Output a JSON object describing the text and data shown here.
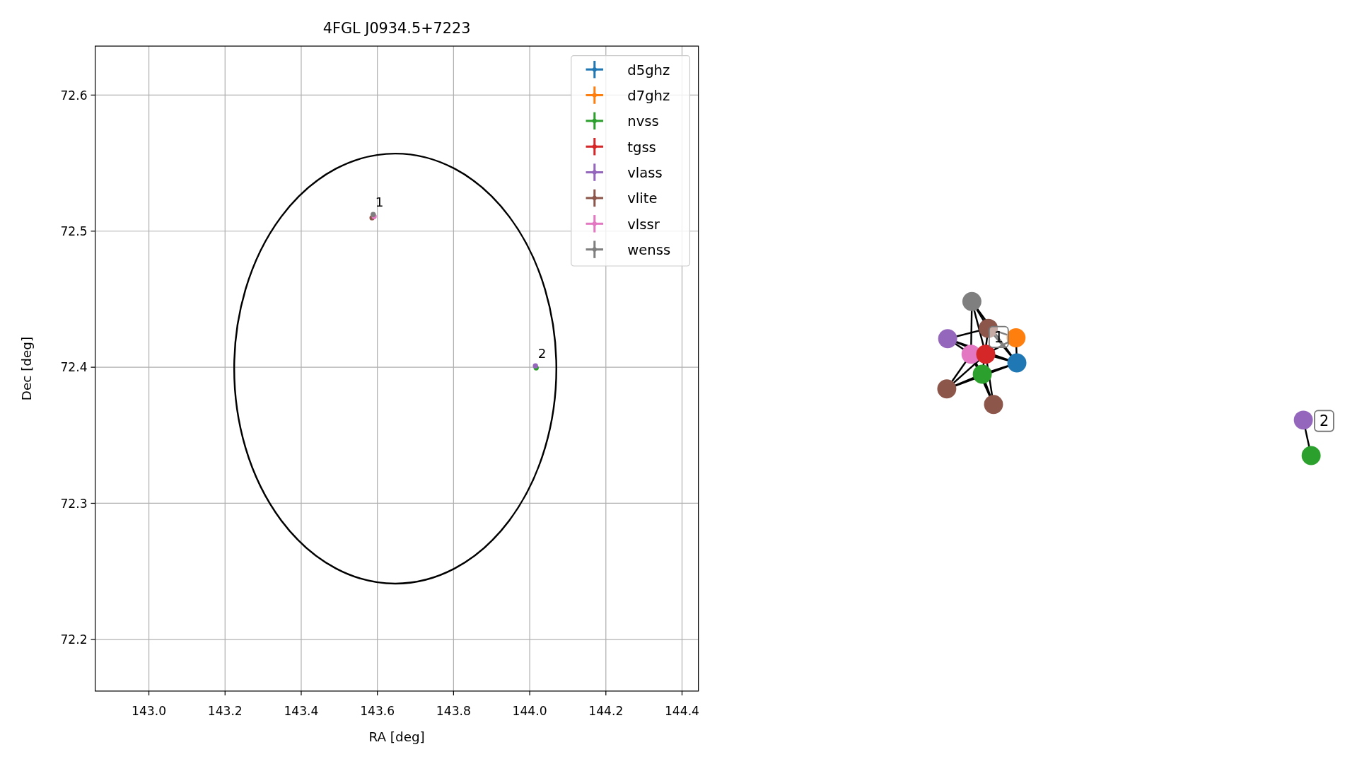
{
  "figure": {
    "chart_data": {
      "type": "scatter",
      "title": "4FGL J0934.5+7223",
      "xlabel": "RA [deg]",
      "ylabel": "Dec [deg]",
      "xlim": [
        142.859,
        144.443
      ],
      "ylim": [
        72.162,
        72.636
      ],
      "grid": true,
      "legend": true,
      "xticks": [
        {
          "value": 143.0,
          "label": "143.0"
        },
        {
          "value": 143.2,
          "label": "143.2"
        },
        {
          "value": 143.4,
          "label": "143.4"
        },
        {
          "value": 143.6,
          "label": "143.6"
        },
        {
          "value": 143.8,
          "label": "143.8"
        },
        {
          "value": 144.0,
          "label": "144.0"
        },
        {
          "value": 144.2,
          "label": "144.2"
        },
        {
          "value": 144.4,
          "label": "144.4"
        }
      ],
      "yticks": [
        {
          "value": 72.2,
          "label": "72.2"
        },
        {
          "value": 72.3,
          "label": "72.3"
        },
        {
          "value": 72.4,
          "label": "72.4"
        },
        {
          "value": 72.5,
          "label": "72.5"
        },
        {
          "value": 72.6,
          "label": "72.6"
        }
      ],
      "series": [
        {
          "name": "d5ghz",
          "color": "#1f77b4"
        },
        {
          "name": "d7ghz",
          "color": "#ff7f0e"
        },
        {
          "name": "nvss",
          "color": "#2ca02c",
          "x": [
            144.017
          ],
          "values": [
            72.3995
          ]
        },
        {
          "name": "tgss",
          "color": "#d62728"
        },
        {
          "name": "vlass",
          "color": "#9467bd",
          "x": [
            144.015
          ],
          "values": [
            72.401
          ]
        },
        {
          "name": "vlite",
          "color": "#8c564b",
          "x": [
            143.586
          ],
          "values": [
            72.5098
          ]
        },
        {
          "name": "vlssr",
          "color": "#e377c2",
          "x": [
            143.5915
          ],
          "values": [
            72.5108
          ]
        },
        {
          "name": "wenss",
          "color": "#7f7f7f",
          "x": [
            143.589
          ],
          "values": [
            72.5122
          ]
        }
      ],
      "annotations": [
        {
          "text": "1",
          "x": 143.59,
          "y": 72.516
        },
        {
          "text": "2",
          "x": 144.017,
          "y": 72.405
        }
      ]
    }
  },
  "network": {
    "clusters": [
      {
        "label": "1",
        "nodes": [
          {
            "color": "#7f7f7f"
          },
          {
            "color": "#8c564b"
          },
          {
            "color": "#9467bd"
          },
          {
            "color": "#ff7f0e"
          },
          {
            "color": "#e377c2"
          },
          {
            "color": "#d62728"
          },
          {
            "color": "#1f77b4"
          },
          {
            "color": "#2ca02c"
          },
          {
            "color": "#8c564b"
          },
          {
            "color": "#8c564b"
          }
        ]
      },
      {
        "label": "2",
        "nodes": [
          {
            "color": "#9467bd"
          },
          {
            "color": "#2ca02c"
          }
        ]
      }
    ]
  }
}
